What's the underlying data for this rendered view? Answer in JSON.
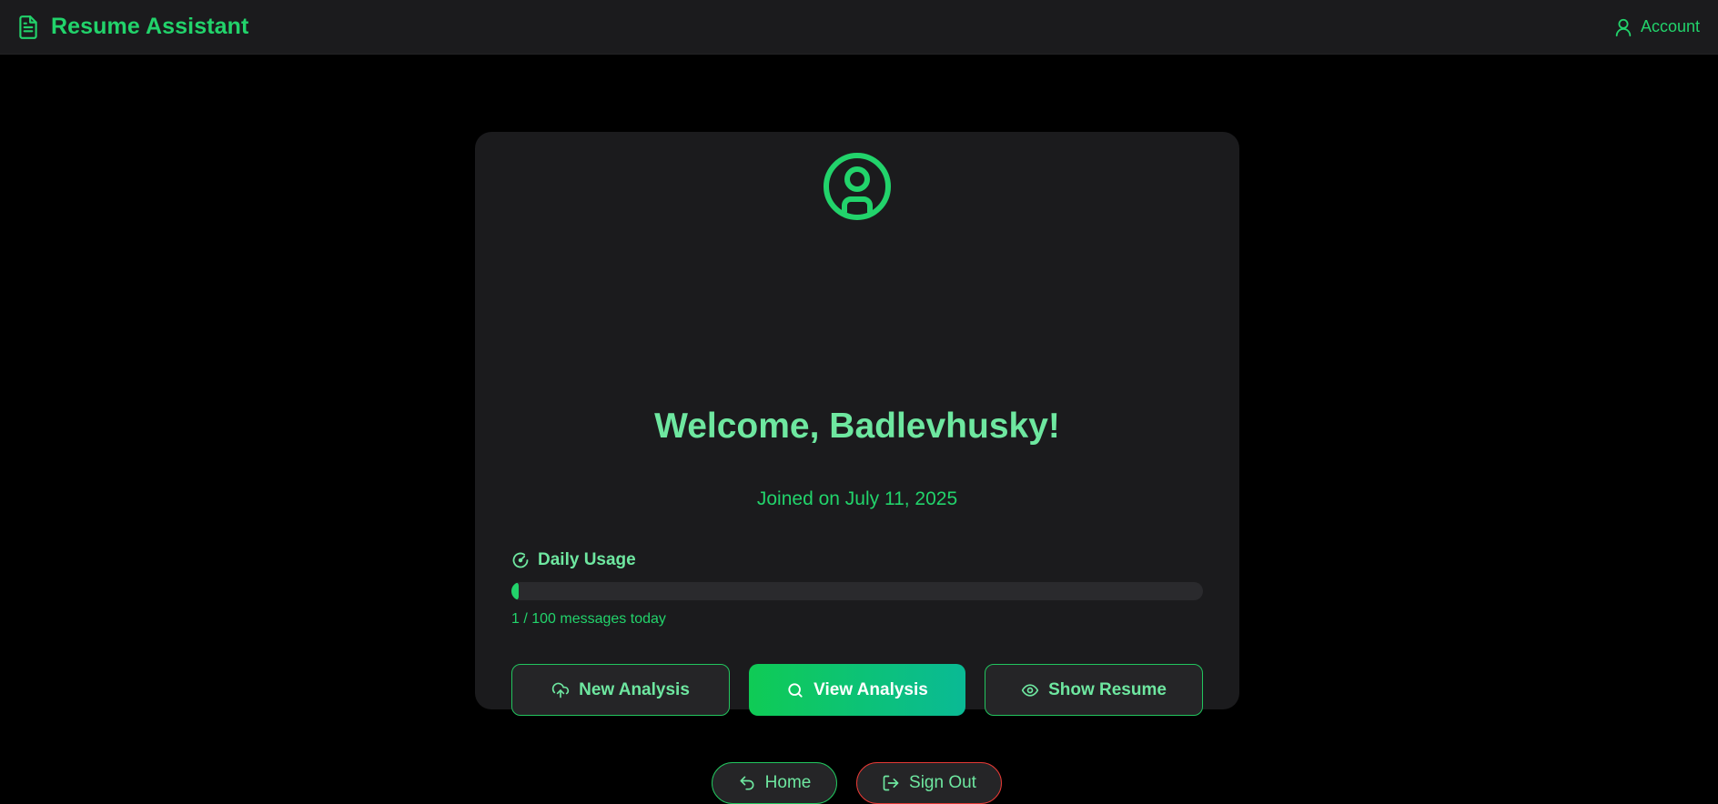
{
  "header": {
    "brand": "Resume Assistant",
    "brand_icon": "file-text-icon",
    "account_label": "Account",
    "account_icon": "user-icon"
  },
  "profile": {
    "avatar_icon": "user-circle-icon",
    "welcome": "Welcome, Badlevhusky!",
    "joined": "Joined on July 11, 2025"
  },
  "usage": {
    "title": "Daily Usage",
    "icon": "gauge-icon",
    "used": 1,
    "limit": 100,
    "text": "1 / 100 messages today"
  },
  "actions": {
    "new_analysis": "New Analysis",
    "view_analysis": "View Analysis",
    "show_resume": "Show Resume"
  },
  "nav": {
    "home": "Home",
    "sign_out": "Sign Out"
  },
  "colors": {
    "accent": "#22d36b",
    "accent_light": "#6ee7a0",
    "danger": "#e53935",
    "background": "#000000",
    "surface": "#1b1b1d"
  }
}
